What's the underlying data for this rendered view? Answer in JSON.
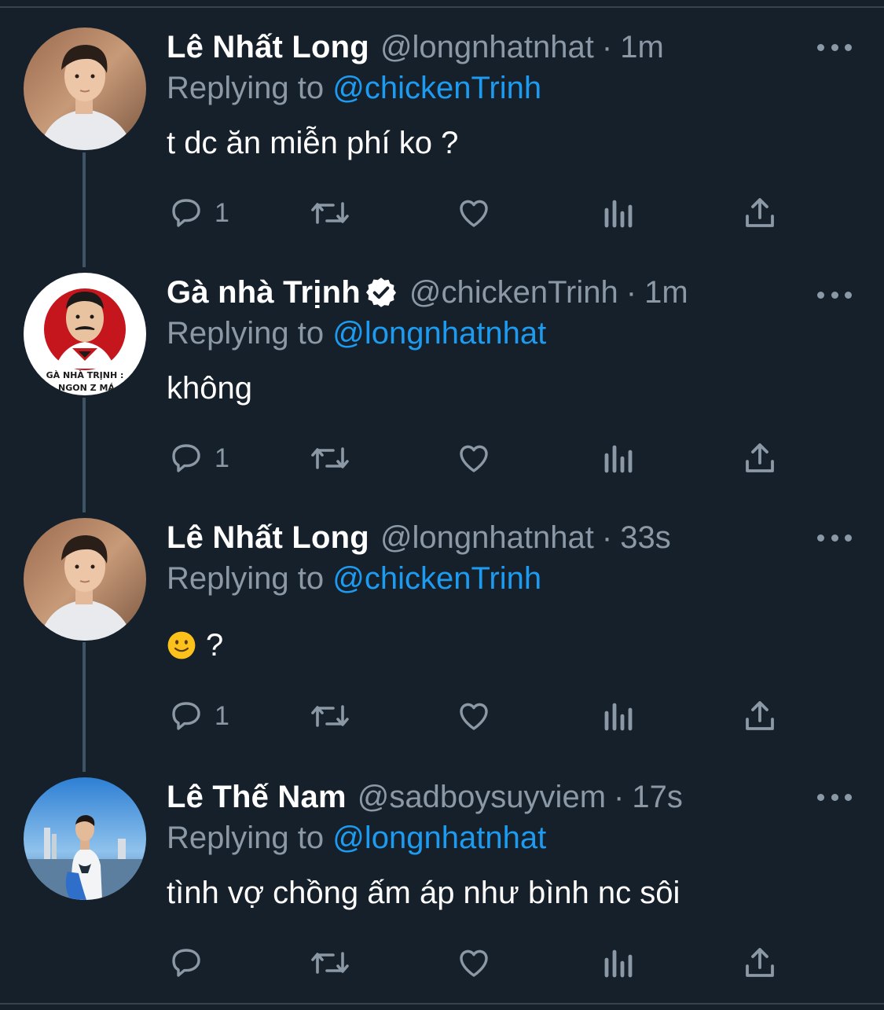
{
  "tweets": [
    {
      "display_name": "Lê Nhất Long",
      "verified": false,
      "handle": "@longnhatnhat",
      "separator": "·",
      "time": "1m",
      "replying_prefix": "Replying to",
      "replying_to": "@chickenTrinh",
      "text": "t dc ăn miễn phí ko ?",
      "reply_count": "1",
      "avatar": "man-light-shirt-photo"
    },
    {
      "display_name": "Gà nhà Trịnh",
      "verified": true,
      "handle": "@chickenTrinh",
      "separator": "·",
      "time": "1m",
      "replying_prefix": "Replying to",
      "replying_to": "@longnhatnhat",
      "text": "không",
      "reply_count": "1",
      "avatar": "logo-red-circle-face",
      "avatar_text_line1": "GÀ NHÀ TRỊNH :",
      "avatar_text_line2": "NGON Z MÁ"
    },
    {
      "display_name": "Lê Nhất Long",
      "verified": false,
      "handle": "@longnhatnhat",
      "separator": "·",
      "time": "33s",
      "replying_prefix": "Replying to",
      "replying_to": "@chickenTrinh",
      "text": "?",
      "emoji": "slightly-smiling-face",
      "reply_count": "1",
      "avatar": "man-light-shirt-photo"
    },
    {
      "display_name": "Lê Thế Nam",
      "verified": false,
      "handle": "@sadboysuyviem",
      "separator": "·",
      "time": "17s",
      "replying_prefix": "Replying to",
      "replying_to": "@longnhatnhat",
      "text": "tình vợ chồng ấm áp như bình nc sôi",
      "reply_count": "",
      "avatar": "man-seaside-photo"
    }
  ],
  "colors": {
    "background": "#15202b",
    "secondary_text": "#8b98a5",
    "accent": "#1d9bf0",
    "thread_line": "#3d5466"
  }
}
